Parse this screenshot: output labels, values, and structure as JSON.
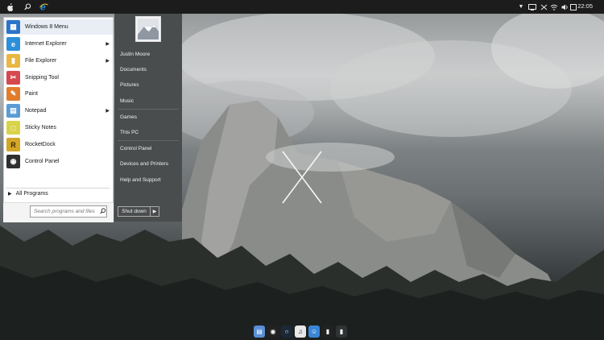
{
  "topbar": {
    "clock": "22:05",
    "left_icons": [
      "apple-icon",
      "search-icon",
      "internet-explorer-icon"
    ],
    "tray_icons": [
      "chevron-down-icon",
      "network-icon",
      "battery-icon",
      "wifi-icon",
      "volume-icon",
      "notification-icon"
    ]
  },
  "start_menu": {
    "pinned": [
      {
        "label": "Windows 8 Menu",
        "icon": "windows-icon",
        "color": "#2b73c9"
      },
      {
        "label": "Internet Explorer",
        "icon": "internet-explorer-icon",
        "color": "#2d8fd9",
        "submenu": true
      },
      {
        "label": "File Explorer",
        "icon": "folder-icon",
        "color": "#e8b743",
        "submenu": true
      },
      {
        "label": "Snipping Tool",
        "icon": "scissors-icon",
        "color": "#d6484f"
      },
      {
        "label": "Paint",
        "icon": "paint-icon",
        "color": "#e07d2d"
      },
      {
        "label": "Notepad",
        "icon": "notepad-icon",
        "color": "#5b9bd5",
        "submenu": true
      },
      {
        "label": "Sticky Notes",
        "icon": "sticky-notes-icon",
        "color": "#d9d34a"
      },
      {
        "label": "RocketDock",
        "icon": "rocketdock-icon",
        "color": "#d3a628"
      },
      {
        "label": "Control Panel",
        "icon": "nvidia-icon",
        "color": "#2f2f2f"
      }
    ],
    "all_programs": "All Programs",
    "search_placeholder": "Search programs and files",
    "user_name": "Justin Moore",
    "right_links_group1": [
      "Documents",
      "Pictures",
      "Music"
    ],
    "right_links_group2": [
      "Games",
      "This PC"
    ],
    "right_links_group3": [
      "Control Panel",
      "Devices and Printers",
      "Help and Support"
    ],
    "shutdown_label": "Shut down"
  },
  "dock": {
    "items": [
      "macbook-icon",
      "alien-icon",
      "steam-icon",
      "itunes-icon",
      "finder-icon",
      "terminal-icon",
      "trash-icon"
    ]
  },
  "colors": {
    "topbar": "#1c1c1c",
    "menu_left_bg": "#ffffff",
    "menu_right_bg": "#4a4d4e"
  }
}
